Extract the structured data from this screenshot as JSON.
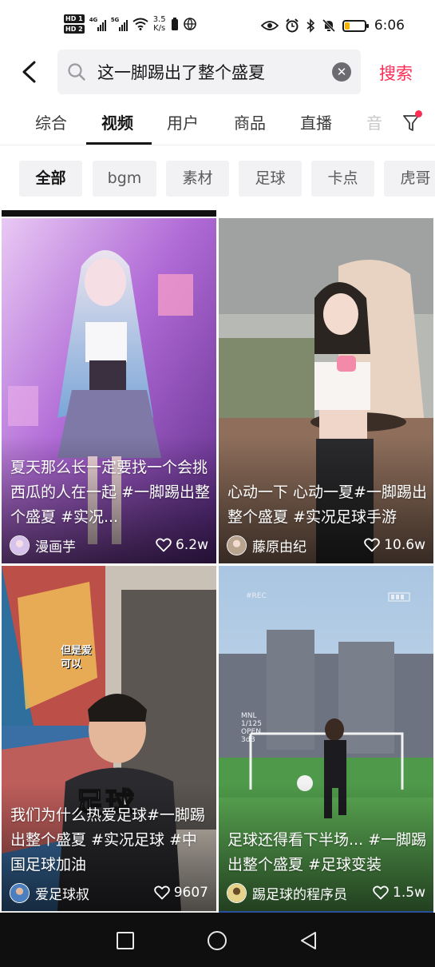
{
  "status_bar": {
    "hd1": "HD 1",
    "hd2": "HD 2",
    "net1": "4G",
    "net2": "5G",
    "speed_value": "3.5",
    "speed_unit": "K/s",
    "time": "6:06",
    "battery_level": 0.22
  },
  "search": {
    "query": "这一脚踢出了整个盛夏",
    "submit_label": "搜索"
  },
  "tabs": [
    "综合",
    "视频",
    "用户",
    "商品",
    "直播",
    "音"
  ],
  "active_tab": "视频",
  "chips": [
    "全部",
    "bgm",
    "素材",
    "足球",
    "卡点",
    "虎哥"
  ],
  "active_chip": "全部",
  "videos": [
    {
      "title": "夏天那么长一定要找一个会挑西瓜的人在一起 #一脚踢出整个盛夏 #实况...",
      "author": "漫画芋",
      "likes": "6.2w"
    },
    {
      "title": "心动一下 心动一夏#一脚踢出整个盛夏 #实况足球手游",
      "author": "藤原由纪",
      "likes": "10.6w"
    },
    {
      "title": "我们为什么热爱足球#一脚踢出整个盛夏 #实况足球 #中国足球加油",
      "author": "爱足球叔",
      "likes": "9607"
    },
    {
      "title": "足球还得看下半场... #一脚踢出整个盛夏 #足球变装",
      "author": "踢足球的程序员",
      "likes": "1.5w"
    }
  ],
  "overlay_texts": {
    "card3_small": "但是爱可以",
    "card3_big": "足球",
    "card4_rec": "#REC",
    "card4_mnl": "MNL",
    "card4_exp": "1/125",
    "card4_open": "OPEN",
    "card4_db": "3dB"
  },
  "colors": {
    "accent": "#fe2c55",
    "chip_bg": "#f2f2f4",
    "nav_bar": "#0f0f0f"
  },
  "icons": [
    "back-arrow-icon",
    "search-icon",
    "clear-icon",
    "filter-icon",
    "heart-icon",
    "square-nav-icon",
    "circle-nav-icon",
    "triangle-back-icon"
  ]
}
